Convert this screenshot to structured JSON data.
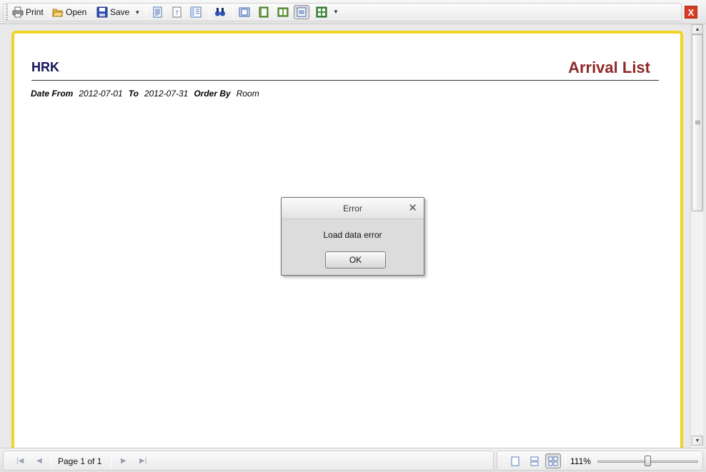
{
  "toolbar": {
    "print_label": "Print",
    "open_label": "Open",
    "save_label": "Save",
    "close_label": "X",
    "icons": [
      "printer-icon",
      "folder-open-icon",
      "floppy-disk-icon",
      "page-layout-icon",
      "page-setup-icon",
      "document-map-icon",
      "find-icon",
      "single-page-icon",
      "book-icon",
      "two-pages-icon",
      "fit-width-icon",
      "export-icon"
    ]
  },
  "report": {
    "company": "HRK",
    "title": "Arrival List",
    "date_from_label": "Date From",
    "date_from": "2012-07-01",
    "to_label": "To",
    "date_to": "2012-07-31",
    "order_by_label": "Order By",
    "order_by": "Room"
  },
  "dialog": {
    "title": "Error",
    "message": "Load data error",
    "ok_label": "OK"
  },
  "statusbar": {
    "page_indicator": "Page 1 of 1",
    "zoom": "111%",
    "zoom_level_fraction": 0.5
  },
  "colors": {
    "page_border": "#f1d323",
    "company": "#14145a",
    "title": "#8d2a2a",
    "close_button": "#d83a23"
  }
}
